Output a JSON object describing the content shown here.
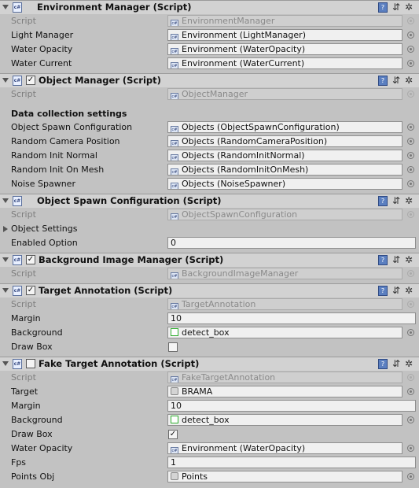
{
  "components": [
    {
      "title": "Environment Manager (Script)",
      "has_enable_checkbox": false,
      "rows": [
        {
          "label": "Script",
          "value": "EnvironmentManager",
          "type": "script"
        },
        {
          "label": "Light Manager",
          "value": "Environment (LightManager)",
          "type": "object"
        },
        {
          "label": "Water Opacity",
          "value": "Environment (WaterOpacity)",
          "type": "object"
        },
        {
          "label": "Water Current",
          "value": "Environment (WaterCurrent)",
          "type": "object"
        }
      ]
    },
    {
      "title": "Object Manager (Script)",
      "has_enable_checkbox": true,
      "enabled": true,
      "rows": [
        {
          "label": "Script",
          "value": "ObjectManager",
          "type": "script"
        },
        {
          "label": "Data collection settings",
          "type": "section"
        },
        {
          "label": "Object Spawn Configuration",
          "value": "Objects (ObjectSpawnConfiguration)",
          "type": "object"
        },
        {
          "label": "Random Camera Position",
          "value": "Objects (RandomCameraPosition)",
          "type": "object"
        },
        {
          "label": "Random Init Normal",
          "value": "Objects (RandomInitNormal)",
          "type": "object"
        },
        {
          "label": "Random Init On Mesh",
          "value": "Objects (RandomInitOnMesh)",
          "type": "object"
        },
        {
          "label": "Noise Spawner",
          "value": "Objects (NoiseSpawner)",
          "type": "object"
        }
      ]
    },
    {
      "title": "Object Spawn Configuration (Script)",
      "has_enable_checkbox": false,
      "rows": [
        {
          "label": "Script",
          "value": "ObjectSpawnConfiguration",
          "type": "script"
        },
        {
          "label": "Object Settings",
          "type": "foldout"
        },
        {
          "label": "Enabled Option",
          "value": "0",
          "type": "number"
        }
      ]
    },
    {
      "title": "Background Image Manager (Script)",
      "has_enable_checkbox": true,
      "enabled": true,
      "rows": [
        {
          "label": "Script",
          "value": "BackgroundImageManager",
          "type": "script"
        }
      ]
    },
    {
      "title": "Target Annotation (Script)",
      "has_enable_checkbox": true,
      "enabled": true,
      "rows": [
        {
          "label": "Script",
          "value": "TargetAnnotation",
          "type": "script"
        },
        {
          "label": "Margin",
          "value": "10",
          "type": "number"
        },
        {
          "label": "Background",
          "value": "detect_box",
          "type": "texture"
        },
        {
          "label": "Draw Box",
          "type": "toggle",
          "checked": false
        }
      ]
    },
    {
      "title": "Fake Target Annotation (Script)",
      "has_enable_checkbox": true,
      "enabled": false,
      "rows": [
        {
          "label": "Script",
          "value": "FakeTargetAnnotation",
          "type": "script"
        },
        {
          "label": "Target",
          "value": "BRAMA",
          "type": "prefab"
        },
        {
          "label": "Margin",
          "value": "10",
          "type": "number"
        },
        {
          "label": "Background",
          "value": "detect_box",
          "type": "texture"
        },
        {
          "label": "Draw Box",
          "type": "toggle",
          "checked": true
        },
        {
          "label": "Water Opacity",
          "value": "Environment (WaterOpacity)",
          "type": "object"
        },
        {
          "label": "Fps",
          "value": "1",
          "type": "number"
        },
        {
          "label": "Points Obj",
          "value": "Points",
          "type": "prefab"
        }
      ]
    }
  ],
  "icons": {
    "script": "script-icon",
    "help": "help-book-icon",
    "preset": "preset-sliders-icon",
    "settings": "gear-icon",
    "picker": "object-picker-icon"
  },
  "glyphs": {
    "script_icon_text": "c#",
    "check_mark": "✓",
    "help": "?",
    "preset": "⇵",
    "gear": "✲"
  }
}
